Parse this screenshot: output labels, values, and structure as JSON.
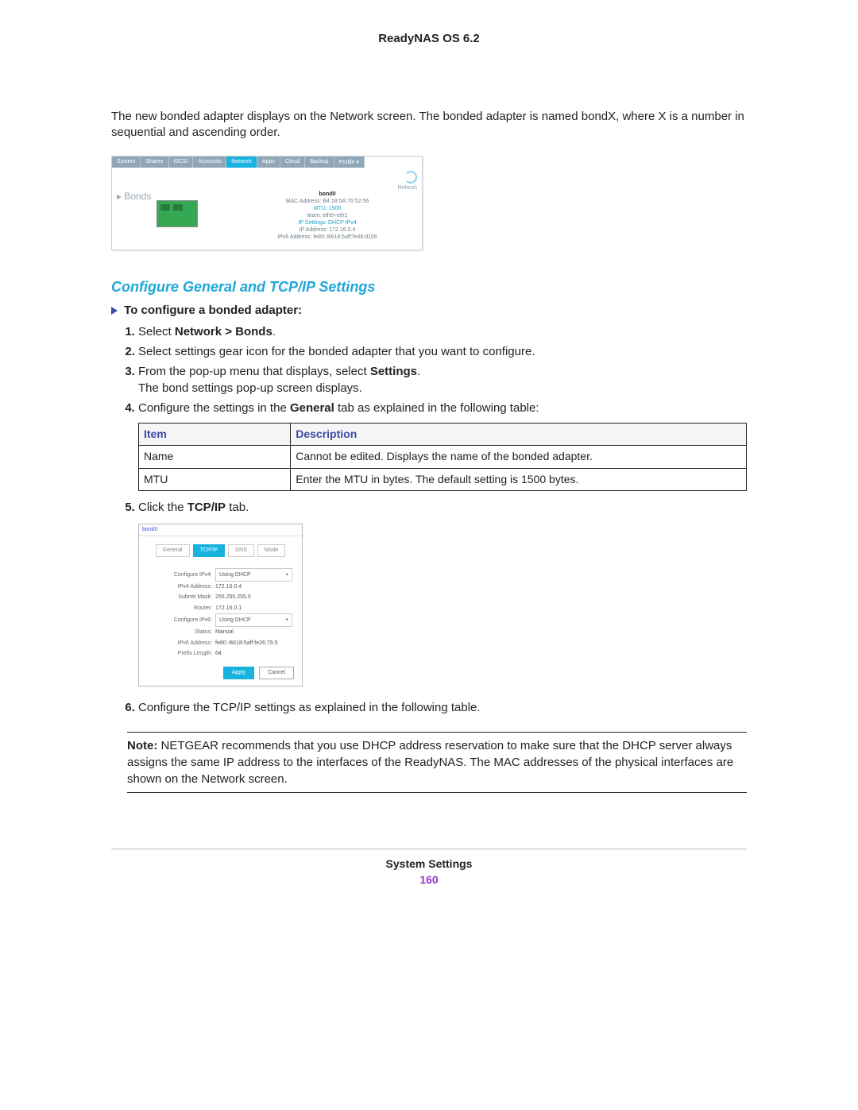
{
  "header": {
    "title": "ReadyNAS OS 6.2"
  },
  "intro": "The new bonded adapter displays on the Network screen. The bonded adapter is named bondX, where X is a number in sequential and ascending order.",
  "shot1": {
    "tabs": [
      "System",
      "Shares",
      "iSCSI",
      "Accounts",
      "Network",
      "Apps",
      "Cloud",
      "Backup",
      "Profile ▾"
    ],
    "active_tab_index": 4,
    "refresh_label": "Refresh",
    "bonds_label": "Bonds",
    "bond": {
      "name": "bond0",
      "mac": "MAC Address: B4:18:5A:76:52:56",
      "mtu": "MTU: 1500",
      "members": "team: eth0+eth1",
      "settings": "IP Settings: DHCP IPv4",
      "ip": "IP Address: 172.16.0.4",
      "ipv6": "IPv6 Address: fe80::B618:5aff:fe46:d106"
    }
  },
  "section_title": "Configure General and TCP/IP Settings",
  "procedure_title": "To configure a bonded adapter:",
  "steps": {
    "s1a": "Select ",
    "s1b": "Network > Bonds",
    "s1c": ".",
    "s2": "Select settings gear icon for the bonded adapter that you want to configure.",
    "s3a": "From the pop-up menu that displays, select ",
    "s3b": "Settings",
    "s3c": ".",
    "s3d": "The bond settings pop-up screen displays.",
    "s4a": "Configure the settings in the ",
    "s4b": "General",
    "s4c": " tab as explained in the following table:",
    "s5a": "Click the ",
    "s5b": "TCP/IP",
    "s5c": " tab.",
    "s6": "Configure the TCP/IP settings as explained in the following table."
  },
  "table": {
    "headers": [
      "Item",
      "Description"
    ],
    "rows": [
      [
        "Name",
        "Cannot be edited. Displays the name of the bonded adapter."
      ],
      [
        "MTU",
        "Enter the MTU in bytes. The default setting is 1500 bytes."
      ]
    ]
  },
  "shot2": {
    "title": "bond0",
    "tabs": [
      "General",
      "TCP/IP",
      "DNS",
      "Mode"
    ],
    "active_tab_index": 1,
    "rows": {
      "cfg4_lab": "Configure IPv4:",
      "cfg4_val": "Using DHCP",
      "ip4_lab": "IPv4 Address:",
      "ip4_val": "172.16.0.4",
      "sm_lab": "Subnet Mask:",
      "sm_val": "255.255.255.0",
      "rt_lab": "Router:",
      "rt_val": "172.16.0.1",
      "cfg6_lab": "Configure IPv6:",
      "cfg6_val": "Using DHCP",
      "st_lab": "Status:",
      "st_val": "Manual",
      "ip6_lab": "IPv6 Address:",
      "ip6_val": "fe80::B618:5aff:fe26:75:5",
      "pl_lab": "Prefix Length:",
      "pl_val": "64"
    },
    "apply": "Apply",
    "cancel": "Cancel"
  },
  "note": {
    "label": "Note:",
    "text": "NETGEAR recommends that you use DHCP address reservation to make sure that the DHCP server always assigns the same IP address to the interfaces of the ReadyNAS. The MAC addresses of the physical interfaces are shown on the Network screen."
  },
  "footer": {
    "section": "System Settings",
    "page": "160"
  }
}
